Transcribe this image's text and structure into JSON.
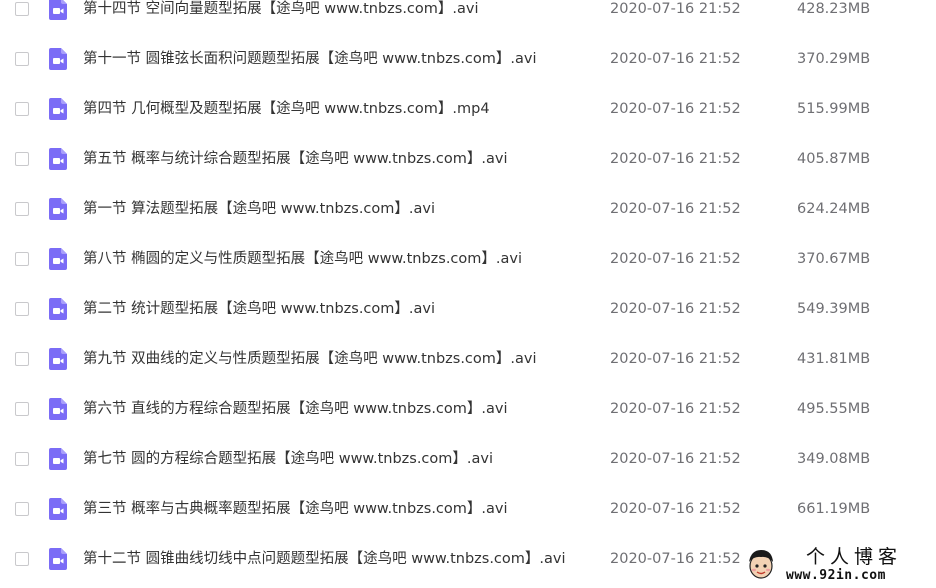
{
  "files": [
    {
      "name": "第十四节 空间向量题型拓展【途鸟吧 www.tnbzs.com】.avi",
      "date": "2020-07-16 21:52",
      "size": "428.23MB"
    },
    {
      "name": "第十一节 圆锥弦长面积问题题型拓展【途鸟吧 www.tnbzs.com】.avi",
      "date": "2020-07-16 21:52",
      "size": "370.29MB"
    },
    {
      "name": "第四节 几何概型及题型拓展【途鸟吧 www.tnbzs.com】.mp4",
      "date": "2020-07-16 21:52",
      "size": "515.99MB"
    },
    {
      "name": "第五节 概率与统计综合题型拓展【途鸟吧 www.tnbzs.com】.avi",
      "date": "2020-07-16 21:52",
      "size": "405.87MB"
    },
    {
      "name": "第一节 算法题型拓展【途鸟吧 www.tnbzs.com】.avi",
      "date": "2020-07-16 21:52",
      "size": "624.24MB"
    },
    {
      "name": "第八节 椭圆的定义与性质题型拓展【途鸟吧 www.tnbzs.com】.avi",
      "date": "2020-07-16 21:52",
      "size": "370.67MB"
    },
    {
      "name": "第二节 统计题型拓展【途鸟吧 www.tnbzs.com】.avi",
      "date": "2020-07-16 21:52",
      "size": "549.39MB"
    },
    {
      "name": "第九节 双曲线的定义与性质题型拓展【途鸟吧 www.tnbzs.com】.avi",
      "date": "2020-07-16 21:52",
      "size": "431.81MB"
    },
    {
      "name": "第六节 直线的方程综合题型拓展【途鸟吧 www.tnbzs.com】.avi",
      "date": "2020-07-16 21:52",
      "size": "495.55MB"
    },
    {
      "name": "第七节 圆的方程综合题型拓展【途鸟吧 www.tnbzs.com】.avi",
      "date": "2020-07-16 21:52",
      "size": "349.08MB"
    },
    {
      "name": "第三节 概率与古典概率题型拓展【途鸟吧 www.tnbzs.com】.avi",
      "date": "2020-07-16 21:52",
      "size": "661.19MB"
    },
    {
      "name": "第十二节 圆锥曲线切线中点问题题型拓展【途鸟吧 www.tnbzs.com】.avi",
      "date": "2020-07-16 21:52",
      "size": ""
    }
  ],
  "colors": {
    "icon_bg": "#7b6cf6",
    "text_primary": "#333333",
    "text_secondary": "#6f6f73"
  },
  "icons": {
    "file_type": "video-file-icon",
    "checkbox": "checkbox-icon"
  },
  "watermark": {
    "title": "个人博客",
    "url": "www.92in.com"
  }
}
